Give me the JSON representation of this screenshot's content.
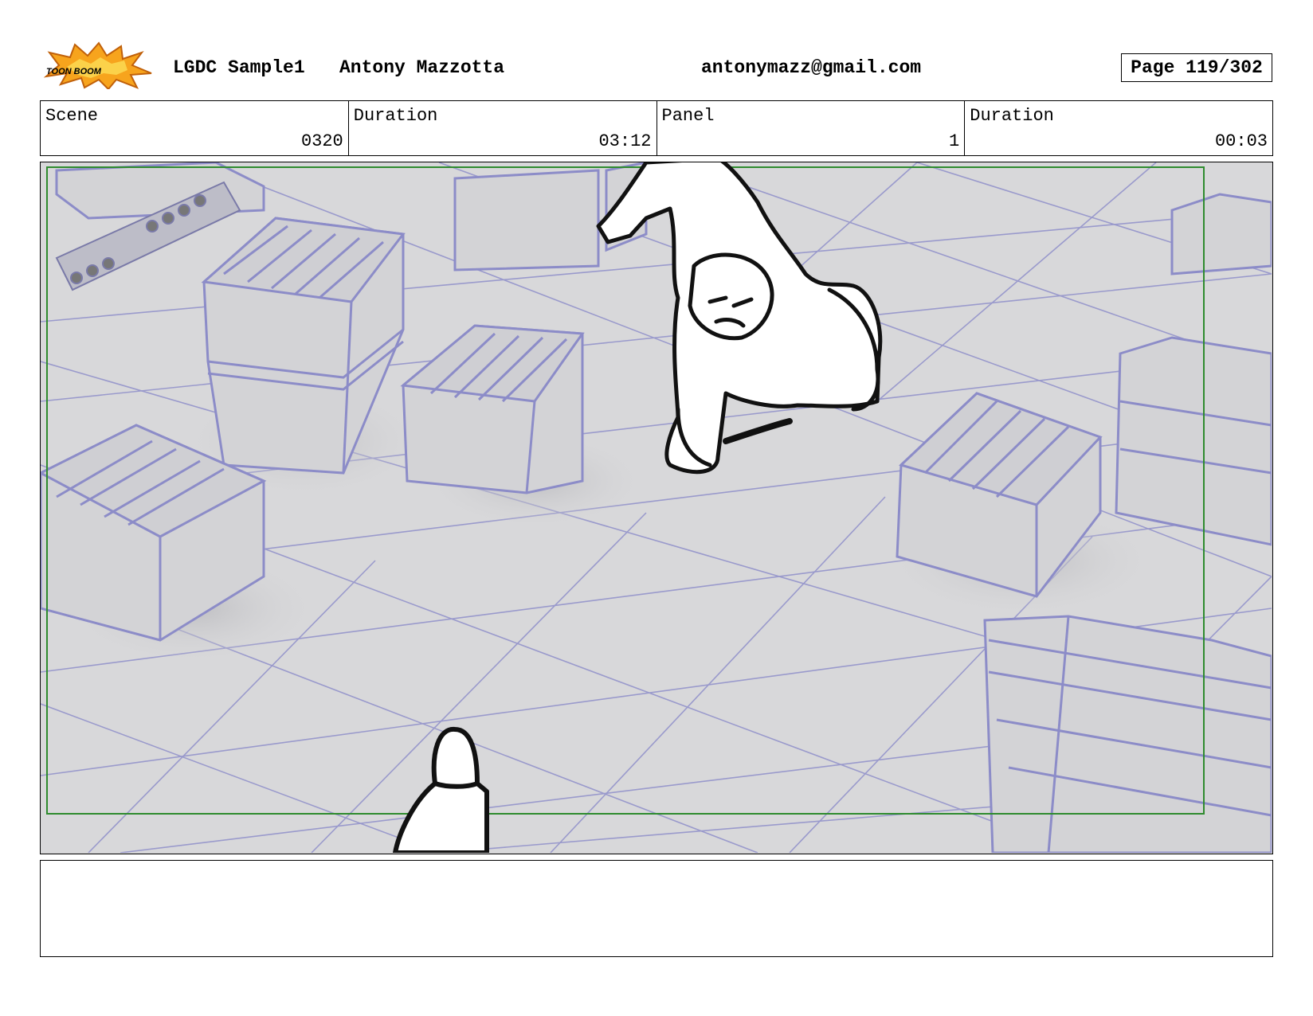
{
  "header": {
    "logo_text": "TOON BOOM",
    "project": "LGDC Sample1",
    "author": "Antony Mazzotta",
    "email": "antonymazz@gmail.com",
    "page": "Page 119/302"
  },
  "info": {
    "scene_label": "Scene",
    "scene_value": "0320",
    "scene_duration_label": "Duration",
    "scene_duration_value": "03:12",
    "panel_label": "Panel",
    "panel_value": "1",
    "panel_duration_label": "Duration",
    "panel_duration_value": "00:03"
  },
  "notes": {
    "text": ""
  }
}
